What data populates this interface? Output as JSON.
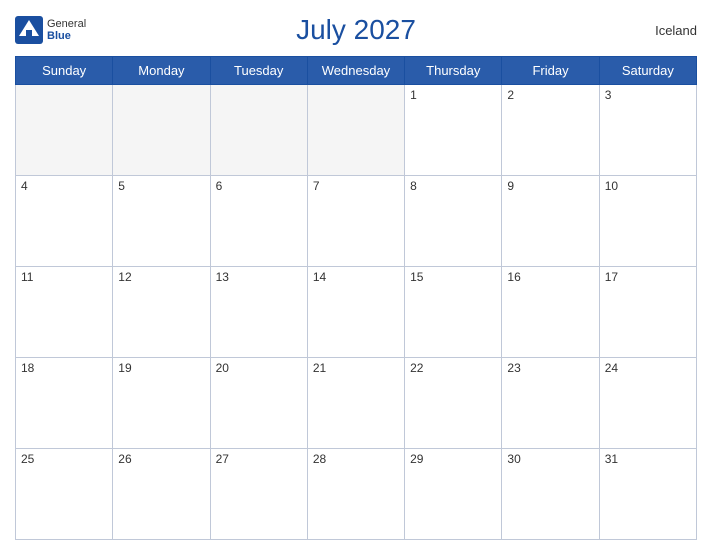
{
  "header": {
    "title": "July 2027",
    "country": "Iceland",
    "logo_general": "General",
    "logo_blue": "Blue"
  },
  "weekdays": [
    "Sunday",
    "Monday",
    "Tuesday",
    "Wednesday",
    "Thursday",
    "Friday",
    "Saturday"
  ],
  "weeks": [
    [
      null,
      null,
      null,
      null,
      1,
      2,
      3
    ],
    [
      4,
      5,
      6,
      7,
      8,
      9,
      10
    ],
    [
      11,
      12,
      13,
      14,
      15,
      16,
      17
    ],
    [
      18,
      19,
      20,
      21,
      22,
      23,
      24
    ],
    [
      25,
      26,
      27,
      28,
      29,
      30,
      31
    ]
  ]
}
